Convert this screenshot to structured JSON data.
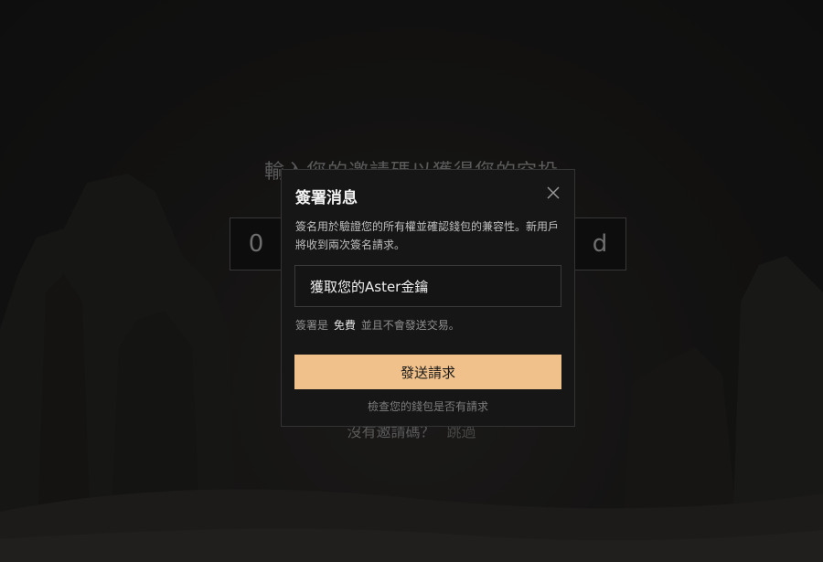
{
  "page": {
    "heading": "輸入您的邀請碼以獲得您的空投",
    "code_chars": [
      "0",
      "",
      "",
      "",
      "",
      "",
      "d"
    ],
    "no_code_text": "沒有邀請碼？",
    "skip_label": "跳過"
  },
  "modal": {
    "title": "簽署消息",
    "close_icon": "close-icon",
    "description": "簽名用於驗證您的所有權並確認錢包的兼容性。新用戶將收到兩次簽名請求。",
    "action_label": "獲取您的Aster金鑰",
    "free_note_prefix": "簽署是",
    "free_word": "免費",
    "free_note_suffix": "並且不會發送交易。",
    "send_label": "發送請求",
    "check_label": "檢查您的錢包是否有請求"
  },
  "colors": {
    "accent": "#f0c18a",
    "background": "#1a1a1a",
    "modal_bg": "#161616"
  }
}
